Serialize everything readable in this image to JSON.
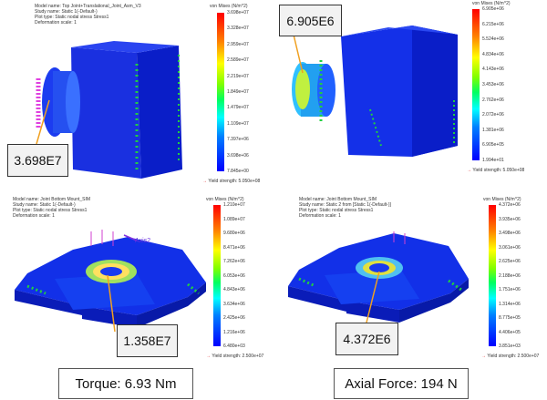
{
  "panels": {
    "tl": {
      "header": [
        "Model name: Top Joint+Translational_Joint_Asm_V3",
        "Study name: Static 1(-Default-)",
        "Plot type: Static nodal stress Stress1",
        "Deformation scale: 1"
      ],
      "legend_title": "von Mises (N/m^2)",
      "ticks": [
        "3.698e+07",
        "3.328e+07",
        "2.959e+07",
        "2.589e+07",
        "2.219e+07",
        "1.849e+07",
        "1.479e+07",
        "1.109e+07",
        "7.397e+06",
        "3.698e+06",
        "7.845e+00"
      ],
      "yield": "Yield strength: 5.050e+08",
      "callout": "3.698E7"
    },
    "tr": {
      "legend_title": "von Mises (N/m^2)",
      "ticks": [
        "6.905e+06",
        "6.215e+06",
        "5.524e+06",
        "4.834e+06",
        "4.143e+06",
        "3.453e+06",
        "2.762e+06",
        "2.072e+06",
        "1.381e+06",
        "6.905e+05",
        "1.994e+01"
      ],
      "yield": "Yield strength: 5.050e+08",
      "callout": "6.905E6"
    },
    "bl": {
      "header": [
        "Model name: Joint Bottom Mount_SIM",
        "Study name: Static 1(-Default-)",
        "Plot type: Static nodal stress Stress1",
        "Deformation scale: 1"
      ],
      "legend_title": "von Mises (N/m^2)",
      "ticks": [
        "1.210e+07",
        "1.089e+07",
        "9.680e+06",
        "8.471e+06",
        "7.262e+06",
        "6.053e+06",
        "4.843e+06",
        "3.634e+06",
        "2.425e+06",
        "1.216e+06",
        "6.480e+03"
      ],
      "yield": "Yield strength: 2.500e+07",
      "callout": "1.358E7",
      "axis_label": "Axis2"
    },
    "br": {
      "header": [
        "Model name: Joint Bottom Mount_SIM",
        "Study name: Static 2 from [Static 1(-Default-)]",
        "Plot type: Static nodal stress Stress1",
        "Deformation scale: 1"
      ],
      "legend_title": "von Mises (N/m^2)",
      "ticks": [
        "4.372e+06",
        "3.935e+06",
        "3.498e+06",
        "3.061e+06",
        "2.625e+06",
        "2.188e+06",
        "1.751e+06",
        "1.314e+06",
        "8.775e+05",
        "4.406e+05",
        "3.851e+03"
      ],
      "yield": "Yield strength: 2.500e+07",
      "callout": "4.372E6"
    }
  },
  "captions": {
    "torque": "Torque: 6.93 Nm",
    "axial": "Axial Force: 194 N"
  },
  "colors": {
    "mesh_blue": "#0a2ee8",
    "leader": "#f0a020",
    "callout_bg": "#f2f2f2"
  }
}
